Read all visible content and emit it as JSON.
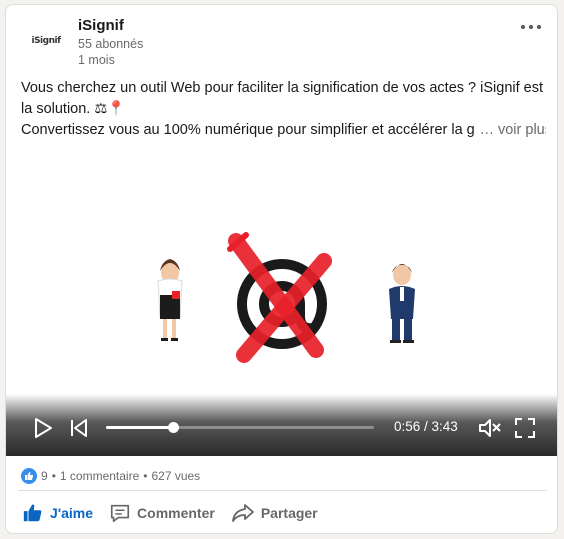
{
  "post": {
    "author": "iSignif",
    "logo_text": "iSignif",
    "followers": "55 abonnés",
    "time": "1 mois",
    "text_line1": "Vous cherchez un outil Web pour faciliter la signification de vos actes ? iSignif est",
    "text_line2": "la solution. ⚖📍",
    "text_line3": "Convertissez vous au 100% numérique pour simplifier et accélérer la g",
    "see_more": "… voir plus"
  },
  "video": {
    "current_time": "0:56",
    "duration": "3:43",
    "time_display": "0:56 / 3:43",
    "progress_fraction": 0.251
  },
  "social": {
    "reaction_count": "9",
    "separator": "•",
    "comments": "1 commentaire",
    "views": "627 vues"
  },
  "actions": {
    "like": "J'aime",
    "comment": "Commenter",
    "share": "Partager"
  },
  "colors": {
    "accent": "#0a66c2",
    "like_badge": "#378fe9",
    "cross": "#e8202a"
  },
  "icons": {
    "more": "more-dots-icon",
    "play": "play-icon",
    "replay": "skip-back-icon",
    "mute": "volume-muted-icon",
    "fullscreen": "fullscreen-icon",
    "like": "thumbs-up-icon",
    "comment": "comment-icon",
    "share": "share-arrow-icon"
  }
}
